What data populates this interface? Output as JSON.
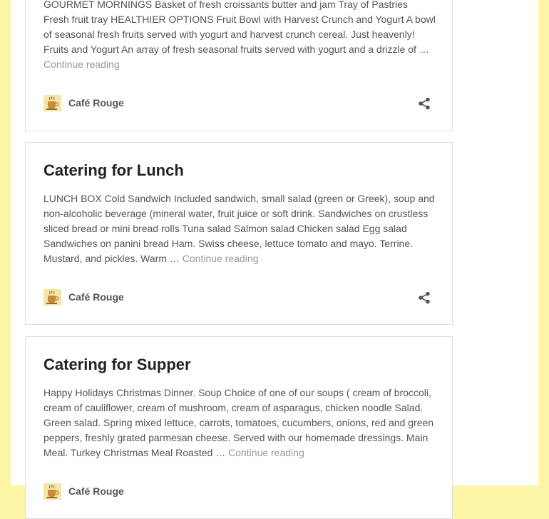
{
  "posts": [
    {
      "title": "",
      "excerpt": "GOURMET MORNINGS Basket of fresh croissants butter and jam Tray of Pastries Fresh fruit tray HEALTHIER OPTIONS Fruit Bowl with Harvest Crunch and Yogurt A bowl of seasonal fresh fruits served with yogurt and harvest crunch cereal. Just heavenly! Fruits and Yogurt An array of fresh seasonal fruits served with yogurt and a drizzle of …",
      "continue_label": "Continue reading",
      "author": "Café Rouge",
      "avatar_icon": "coffee-cup-icon",
      "share_icon": "share-icon"
    },
    {
      "title": "Catering for Lunch",
      "excerpt": "LUNCH BOX Cold Sandwich Included sandwich, small salad (green or Greek), soup and non-alcoholic beverage (mineral water, fruit juice or soft drink. Sandwiches on crustless sliced bread or mini bread rolls Tuna salad Salmon salad Chicken salad Egg salad Sandwiches on panini bread Ham. Swiss cheese, lettuce tomato and mayo. Terrine. Mustard, and pickles. Warm …",
      "continue_label": "Continue reading",
      "author": "Café Rouge",
      "avatar_icon": "coffee-cup-icon",
      "share_icon": "share-icon"
    },
    {
      "title": "Catering for Supper",
      "excerpt": "Happy Holidays Christmas Dinner. Soup Choice of one of our soups ( cream of broccoli, cream of cauliflower, cream of mushroom, cream of asparagus, chicken noodle Salad. Green salad. Spring mixed lettuce, carrots, tomatoes, cucumbers, onions, red and green peppers, freshly grated parmesan cheese. Served with our homemade dressings. Main Meal. Turkey Christmas Meal Roasted …",
      "continue_label": "Continue reading",
      "author": "Café Rouge",
      "avatar_icon": "coffee-cup-icon",
      "share_icon": "share-icon"
    }
  ],
  "colors": {
    "background": "#fbf5a6",
    "card_border": "#dddddd",
    "title": "#222222",
    "text": "#555555",
    "link": "#999999"
  }
}
